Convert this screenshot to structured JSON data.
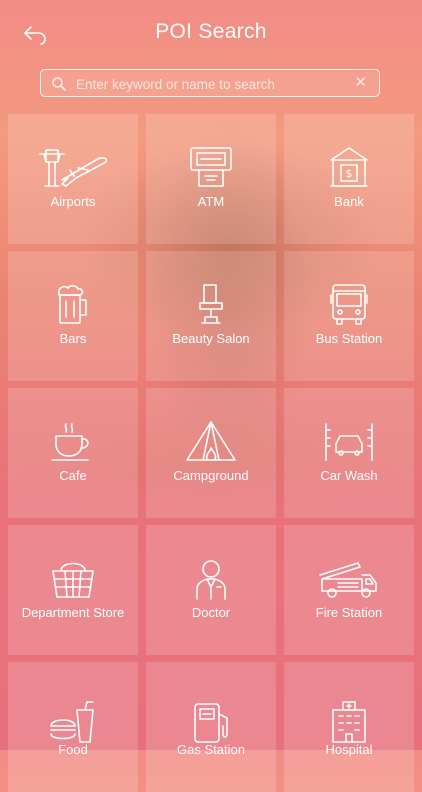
{
  "header": {
    "title": "POI Search"
  },
  "search": {
    "placeholder": "Enter keyword or name to search",
    "clear_symbol": "✕"
  },
  "categories": [
    {
      "label": "Airports",
      "icon": "airport-icon"
    },
    {
      "label": "ATM",
      "icon": "atm-icon"
    },
    {
      "label": "Bank",
      "icon": "bank-icon"
    },
    {
      "label": "Bars",
      "icon": "beer-mug-icon"
    },
    {
      "label": "Beauty Salon",
      "icon": "salon-chair-icon"
    },
    {
      "label": "Bus Station",
      "icon": "bus-icon"
    },
    {
      "label": "Cafe",
      "icon": "coffee-cup-icon"
    },
    {
      "label": "Campground",
      "icon": "tent-icon"
    },
    {
      "label": "Car Wash",
      "icon": "car-wash-icon"
    },
    {
      "label": "Department Store",
      "icon": "shopping-basket-icon"
    },
    {
      "label": "Doctor",
      "icon": "doctor-icon"
    },
    {
      "label": "Fire Station",
      "icon": "fire-truck-icon"
    },
    {
      "label": "Food",
      "icon": "fast-food-icon"
    },
    {
      "label": "Gas Station",
      "icon": "gas-pump-icon"
    },
    {
      "label": "Hospital",
      "icon": "hospital-icon"
    }
  ]
}
